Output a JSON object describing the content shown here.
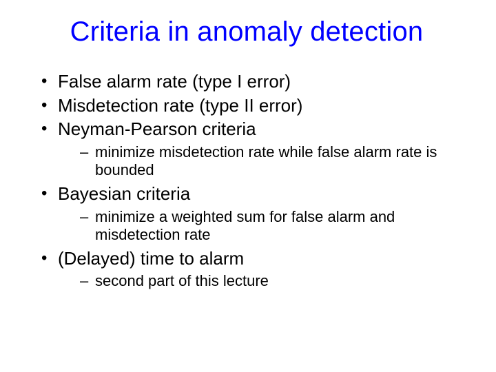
{
  "title": "Criteria in anomaly detection",
  "bullets": [
    {
      "text": "False alarm rate (type I error)"
    },
    {
      "text": "Misdetection rate (type II error)"
    },
    {
      "text": "Neyman-Pearson criteria",
      "sub": [
        "minimize misdetection rate while false alarm rate is bounded"
      ]
    },
    {
      "text": "Bayesian criteria",
      "sub": [
        "minimize a weighted sum for false alarm and misdetection rate"
      ]
    },
    {
      "text": "(Delayed) time to alarm",
      "sub": [
        "second part of this lecture"
      ]
    }
  ]
}
